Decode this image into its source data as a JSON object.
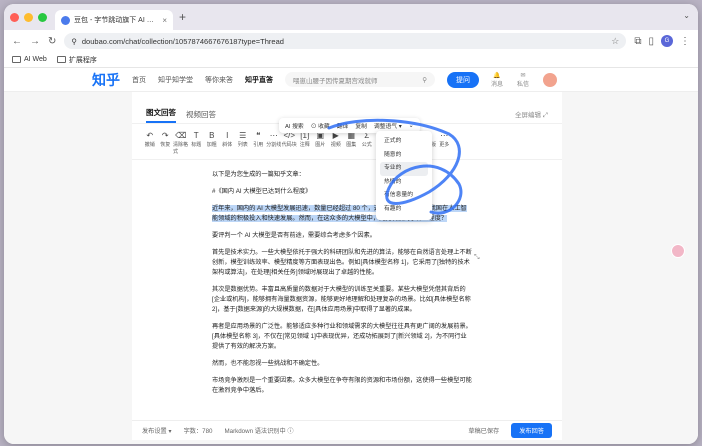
{
  "browser": {
    "tab_title": "豆包 - 字节跳动旗下 AI 智能助手",
    "tab_close": "×",
    "new_tab": "+",
    "tab_menu": "⌄",
    "url": "doubao.com/chat/collection/1057874667676187type=Thread",
    "bookmarks": [
      "AI Web",
      "扩展程序"
    ],
    "profile_initial": "G"
  },
  "zhihu": {
    "logo": "知乎",
    "nav": [
      "首页",
      "知乎知学堂",
      "等你来答",
      "知乎直答"
    ],
    "search_placeholder": "喂崽山腰子因传夏期宫戏就师",
    "ask": "提问",
    "icons": [
      "消息",
      "私信"
    ]
  },
  "editor": {
    "tabs": [
      "图文回答",
      "视频回答"
    ],
    "fullscreen": "全屏编辑 ⤢",
    "format_tools": [
      {
        "g": "↶",
        "l": "撤销"
      },
      {
        "g": "↷",
        "l": "恢复"
      },
      {
        "g": "⌫",
        "l": "清除格式"
      },
      {
        "g": "T",
        "l": "标题"
      },
      {
        "g": "B",
        "l": "加粗"
      },
      {
        "g": "I",
        "l": "斜体"
      },
      {
        "g": "☰",
        "l": "列表"
      },
      {
        "g": "❝",
        "l": "引用"
      },
      {
        "g": "⋯",
        "l": "分割线"
      },
      {
        "g": "</>",
        "l": "代码块"
      },
      {
        "g": "[1]",
        "l": "注释"
      },
      {
        "g": "▣",
        "l": "图片"
      },
      {
        "g": "▶",
        "l": "视频"
      },
      {
        "g": "▦",
        "l": "图集"
      },
      {
        "g": "Σ",
        "l": "公式"
      },
      {
        "g": "⊞",
        "l": "表格"
      },
      {
        "g": "⚯",
        "l": "附件"
      },
      {
        "g": "▭",
        "l": "文档"
      },
      {
        "g": "⏲",
        "l": "历史版本"
      },
      {
        "g": "⋯",
        "l": "更多"
      }
    ],
    "paragraphs": [
      "以下是为您生成的一篇知乎文章：",
      "#《国内 AI 大模型已达到什么程度》",
      "近年来，国内的 AI 大模型发展迅速，数量已经超过 80 个，这一数据不仅体现了我国在人工智能领域的积极投入和快速发展。然而，在这众多的大模型中，究竟发展到了什么程度？",
      "要评判一个 AI 大模型是否有前途，需要综合考虑多个因素。",
      "首先是技术实力。一些大模型依托于强大的科研团队和先进的算法，能够在自然语言处理上不断创新，模型训练效率、模型精度等方面表现出色。例如[具体模型名称 1]，它采用了[独特的技术架构或算法]，在处理[相关任务]领域时展现出了卓越的性能。",
      "其次是数据优势。丰富且高质量的数据对于大模型的训练至关重要。某些大模型凭借其背后的[企业或机构]，能够拥有海量数据资源，能够更好地理解和处理复杂的场景。比如[具体模型名称 2]，基于[数据来源]的大规模数据，在[具体应用场景]中取得了显著的成果。",
      "再者是应用场景的广泛性。能够适应多种行业和领域需求的大模型往往具有更广阔的发展前景。[具体模型名称 3]，不仅在[常见领域 1]中表现优异，还成功拓展到了[新兴领域 2]，为不同行业提供了有效的解决方案。",
      "然而，也不能忽视一些挑战和不确定性。",
      "市场竞争激烈是一个重要因素。众多大模型在争夺有限的资源和市场份额，这使得一些模型可能在激烈竞争中落后。"
    ],
    "float_toolbar": [
      "AI 搜索",
      "⊙ 收藏",
      "翻译",
      "复制",
      "调整语气 ▾",
      "⌄"
    ],
    "tone_options": [
      "正式的",
      "随意的",
      "专业的",
      "热情的",
      "有信息量的",
      "有趣的"
    ],
    "tone_selected_index": 2,
    "bottom": {
      "publish_settings": "发布设置 ▾",
      "word_count": "字数：780",
      "markdown_hint": "Markdown 语法识别中 ⓘ",
      "saved": "草稿已保存",
      "publish": "发布回答"
    }
  }
}
